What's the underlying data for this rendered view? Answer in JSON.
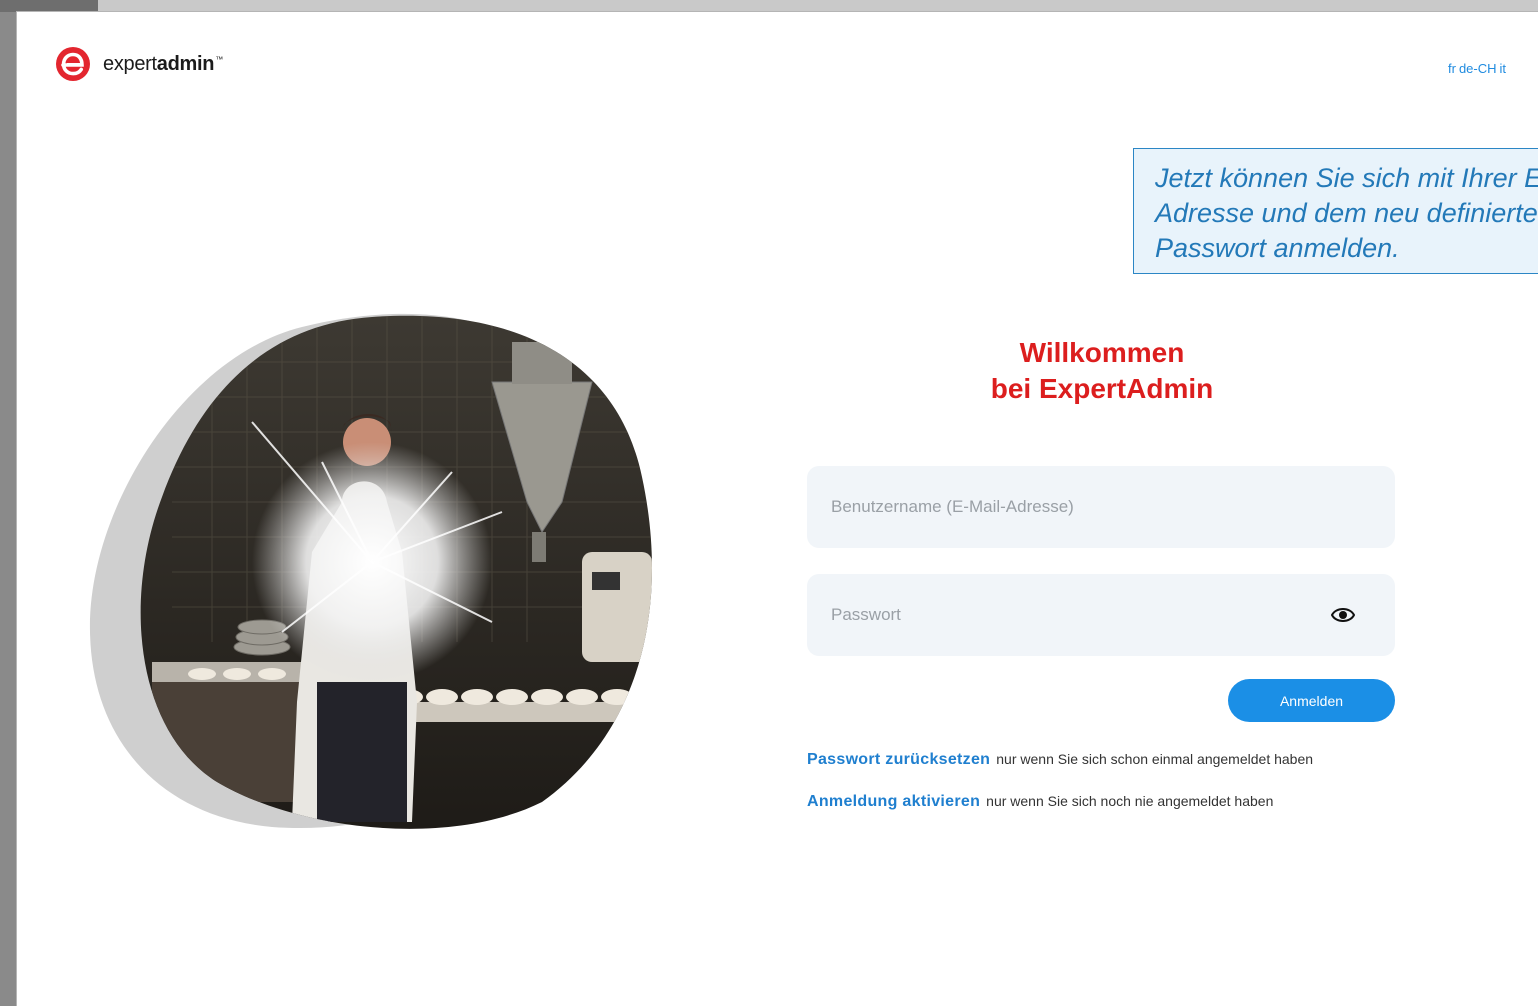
{
  "header": {
    "brand_prefix": "expert",
    "brand_suffix": "admin",
    "brand_mark": "™",
    "logo_color": "#e3262f",
    "languages": [
      "fr",
      "de-CH",
      "it"
    ]
  },
  "callout": {
    "text": "Jetzt können Sie sich mit Ihrer E-Mail-\nAdresse und dem neu definierten\nPasswort anmelden."
  },
  "login": {
    "title_line1": "Willkommen",
    "title_line2": "bei ExpertAdmin",
    "username_placeholder": "Benutzername (E-Mail-Adresse)",
    "password_placeholder": "Passwort",
    "submit_label": "Anmelden",
    "accent_color": "#1b8fe6",
    "title_color": "#dc1e1e"
  },
  "links": [
    {
      "label": "Passwort zurücksetzen",
      "hint": "nur wenn Sie sich schon einmal angemeldet haben"
    },
    {
      "label": "Anmeldung aktivieren",
      "hint": "nur wenn Sie sich noch nie angemeldet haben"
    }
  ],
  "icons": {
    "logo": "e-logo-icon",
    "password_toggle": "eye-icon"
  }
}
